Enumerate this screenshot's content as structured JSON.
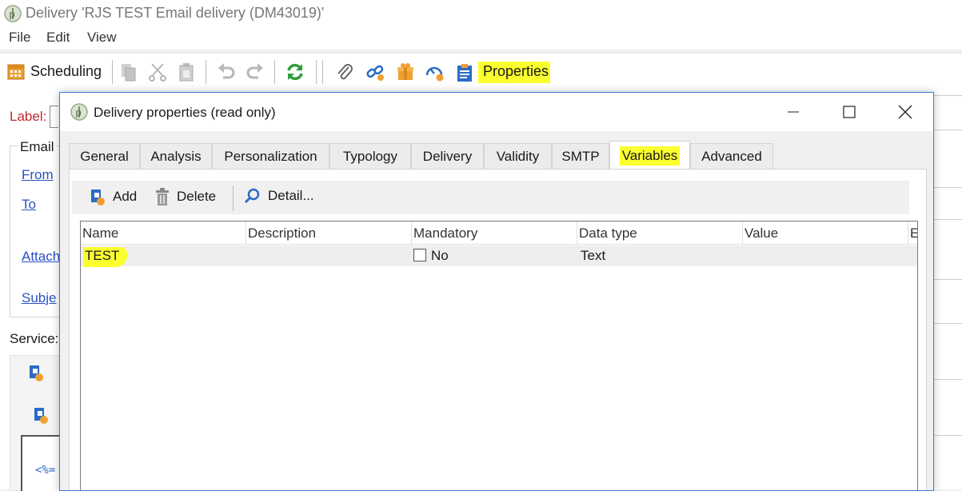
{
  "window": {
    "title": "Delivery 'RJS TEST Email delivery (DM43019)'"
  },
  "menu": [
    "File",
    "Edit",
    "View"
  ],
  "toolbar": {
    "scheduling_label": "Scheduling",
    "properties_label": "Properties"
  },
  "form": {
    "label_prefix": "Label:",
    "email_group": "Email",
    "from_link": "From",
    "to_link": "To",
    "attach_link": "Attach",
    "subject_link": "Subje",
    "services_label": "Service:",
    "code_snippet": "<%="
  },
  "dialog": {
    "title": "Delivery properties (read only)",
    "tabs": [
      "General",
      "Analysis",
      "Personalization",
      "Typology",
      "Delivery",
      "Validity",
      "SMTP",
      "Variables",
      "Advanced"
    ],
    "active_tab": "Variables",
    "actions": {
      "add": "Add",
      "delete": "Delete",
      "detail": "Detail..."
    },
    "columns": [
      "Name",
      "Description",
      "Mandatory",
      "Data type",
      "Value",
      "Ex"
    ],
    "rows": [
      {
        "name": "TEST",
        "description": "",
        "mandatory": "No",
        "mandatory_checked": false,
        "data_type": "Text",
        "value": ""
      }
    ]
  },
  "colors": {
    "highlight": "#fbff2e",
    "link": "#2a4fc7",
    "label_red": "#c0282d",
    "accent_orange": "#f0a030",
    "refresh_green": "#2e9e3a"
  }
}
